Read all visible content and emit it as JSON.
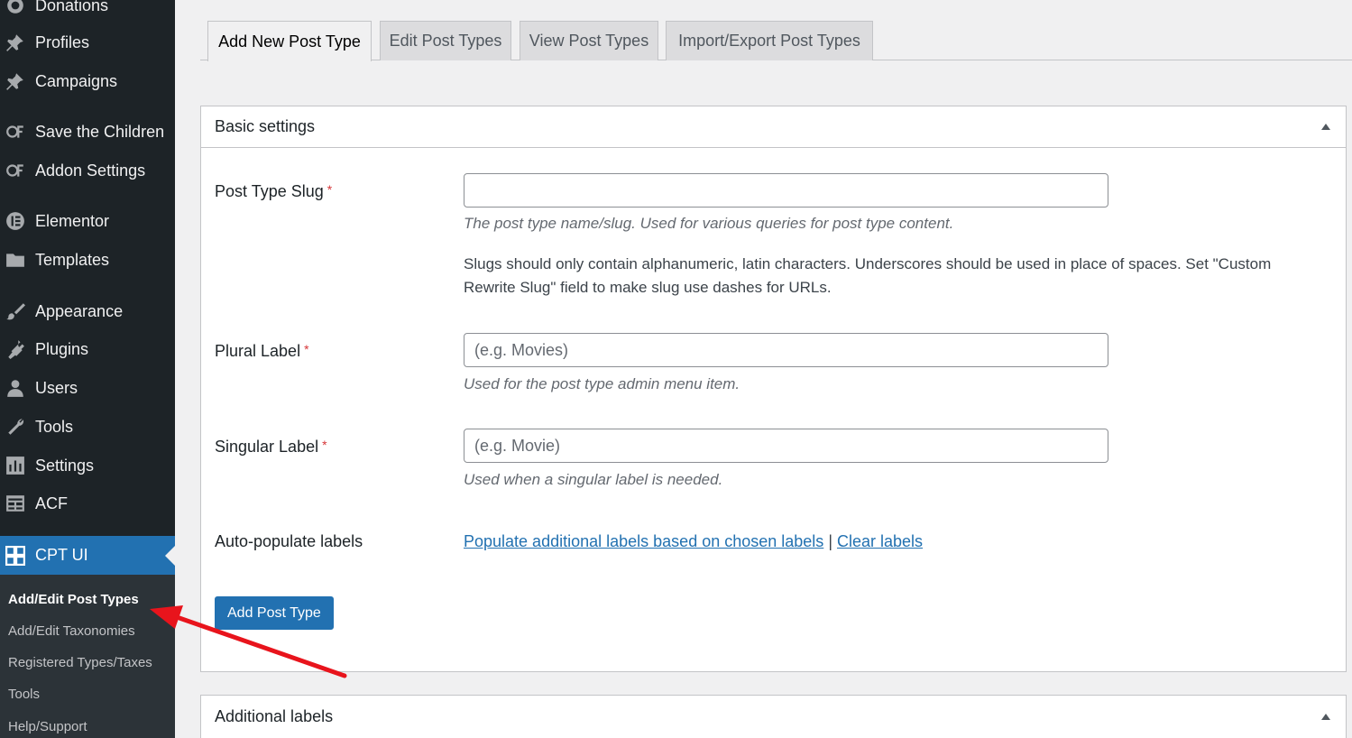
{
  "sidebar": {
    "items": [
      {
        "label": "Donations",
        "icon": "donations-icon"
      },
      {
        "label": "Profiles",
        "icon": "pin-icon"
      },
      {
        "label": "Campaigns",
        "icon": "pin-icon"
      },
      {
        "label": "Save the Children",
        "icon": "money-icon"
      },
      {
        "label": "Addon Settings",
        "icon": "money-icon"
      },
      {
        "label": "Elementor",
        "icon": "elementor-icon"
      },
      {
        "label": "Templates",
        "icon": "folder-icon"
      },
      {
        "label": "Appearance",
        "icon": "brush-icon"
      },
      {
        "label": "Plugins",
        "icon": "plugin-icon"
      },
      {
        "label": "Users",
        "icon": "user-icon"
      },
      {
        "label": "Tools",
        "icon": "wrench-icon"
      },
      {
        "label": "Settings",
        "icon": "settings-icon"
      },
      {
        "label": "ACF",
        "icon": "acf-icon"
      },
      {
        "label": "CPT UI",
        "icon": "cptui-icon"
      }
    ],
    "submenu": [
      "Add/Edit Post Types",
      "Add/Edit Taxonomies",
      "Registered Types/Taxes",
      "Tools",
      "Help/Support"
    ]
  },
  "tabs": [
    "Add New Post Type",
    "Edit Post Types",
    "View Post Types",
    "Import/Export Post Types"
  ],
  "basic_settings": {
    "title": "Basic settings",
    "slug": {
      "label": "Post Type Slug",
      "required": "*",
      "value": "",
      "description": "The post type name/slug. Used for various queries for post type content.",
      "note": "Slugs should only contain alphanumeric, latin characters. Underscores should be used in place of spaces. Set \"Custom Rewrite Slug\" field to make slug use dashes for URLs."
    },
    "plural": {
      "label": "Plural Label",
      "required": "*",
      "placeholder": "(e.g. Movies)",
      "description": "Used for the post type admin menu item."
    },
    "singular": {
      "label": "Singular Label",
      "required": "*",
      "placeholder": "(e.g. Movie)",
      "description": "Used when a singular label is needed."
    },
    "auto_populate": {
      "label": "Auto-populate labels",
      "populate_link": "Populate additional labels based on chosen labels",
      "separator": "|",
      "clear_link": "Clear labels"
    },
    "submit_label": "Add Post Type"
  },
  "additional_labels": {
    "title": "Additional labels"
  },
  "colors": {
    "sidebar_bg": "#1d2327",
    "active_menu": "#2271b1",
    "annotation_arrow": "#e8141c"
  }
}
